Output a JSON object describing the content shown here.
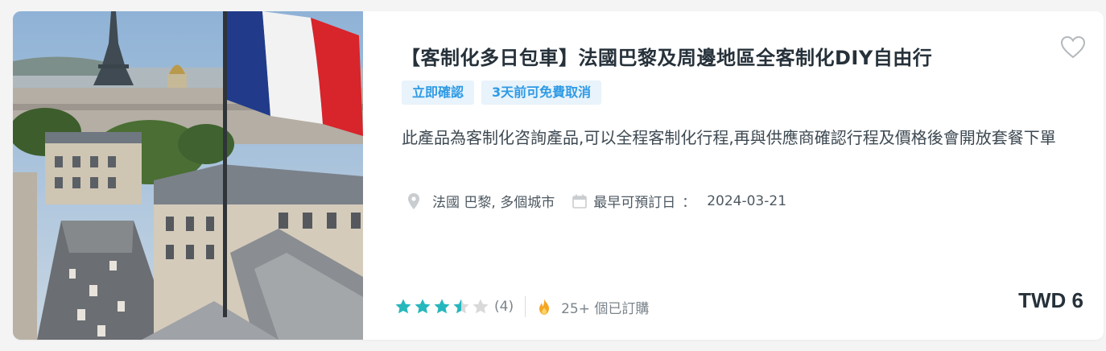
{
  "product": {
    "title": "【客制化多日包車】法國巴黎及周邊地區全客制化DIY自由行",
    "tags": [
      "立即確認",
      "3天前可免費取消"
    ],
    "description": "此產品為客制化咨詢產品,可以全程客制化行程,再與供應商確認行程及價格後會開放套餐下單",
    "location": "法國 巴黎, 多個城市",
    "earliest_booking_label": "最早可預訂日",
    "earliest_booking_sep": "：",
    "earliest_booking_date": "2024-03-21",
    "rating": 3.5,
    "rating_max": 5,
    "review_count": "(4)",
    "booked_text": "25+ 個已訂購",
    "price": "TWD 6"
  },
  "icons": {
    "wishlist": "heart-outline-icon",
    "location": "map-pin-icon",
    "date": "calendar-icon",
    "popularity": "fire-icon",
    "rating": "star-icon"
  },
  "colors": {
    "star_filled": "#26b7bc",
    "star_empty": "#d9d9d9",
    "tag_bg": "#e8f3fb",
    "tag_text": "#2e9ae5",
    "fire": "#f5a623"
  }
}
